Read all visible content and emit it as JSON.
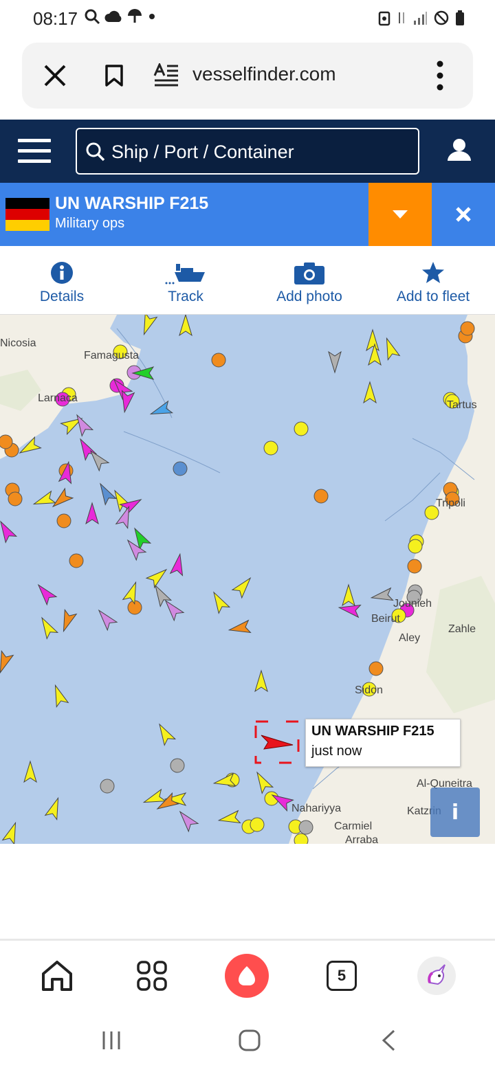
{
  "status_bar": {
    "time": "08:17"
  },
  "browser": {
    "url": "vesselfinder.com"
  },
  "site_header": {
    "search_placeholder": "Ship / Port / Container"
  },
  "vessel": {
    "name": "UN WARSHIP F215",
    "type": "Military ops",
    "flag_colors": [
      "#000000",
      "#dd0000",
      "#ffce00"
    ]
  },
  "actions": [
    {
      "label": "Details",
      "icon": "info-icon"
    },
    {
      "label": "Track",
      "icon": "ship-track-icon"
    },
    {
      "label": "Add photo",
      "icon": "camera-icon"
    },
    {
      "label": "Add to fleet",
      "icon": "star-icon"
    }
  ],
  "map": {
    "popup": {
      "name": "UN WARSHIP F215",
      "time": "just now"
    },
    "info_button": "i",
    "places": [
      {
        "name": "Nicosia"
      },
      {
        "name": "Famagusta"
      },
      {
        "name": "Larnaca"
      },
      {
        "name": "Tartus"
      },
      {
        "name": "Tripoli"
      },
      {
        "name": "Jounieh"
      },
      {
        "name": "Beirut"
      },
      {
        "name": "Zahle"
      },
      {
        "name": "Aley"
      },
      {
        "name": "Sidon"
      },
      {
        "name": "Al-Quneitra"
      },
      {
        "name": "Nahariyya"
      },
      {
        "name": "Katzrin"
      },
      {
        "name": "Carmiel"
      },
      {
        "name": "Arraba"
      }
    ],
    "colors": {
      "sea": "#b4ccea",
      "land": "#f2efe6",
      "selected_vessel": "#e8141c"
    }
  },
  "bottom_nav": {
    "tab_count": "5"
  }
}
